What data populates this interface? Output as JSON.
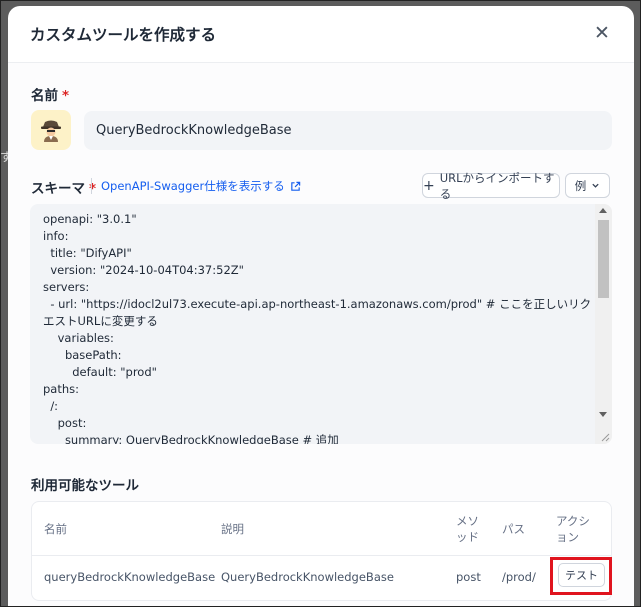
{
  "background": {
    "hint_text": "す"
  },
  "dialog": {
    "title": "カスタムツールを作成する",
    "close_icon": "close-icon",
    "name": {
      "label": "名前",
      "required": "*",
      "value": "QueryBedrockKnowledgeBase",
      "avatar_icon": "detective-icon"
    },
    "schema": {
      "label": "スキーマ",
      "required": "*",
      "swagger_link": "OpenAPI-Swagger仕様を表示する",
      "import_button": "URLからインポートする",
      "example_button": "例",
      "code": "openapi: \"3.0.1\"\ninfo:\n  title: \"DifyAPI\"\n  version: \"2024-10-04T04:37:52Z\"\nservers:\n  - url: \"https://idocl2ul73.execute-api.ap-northeast-1.amazonaws.com/prod\" # ここを正しいリクエストURLに変更する\n    variables:\n      basePath:\n        default: \"prod\"\npaths:\n  /:\n    post:\n      summary: QueryBedrockKnowledgeBase # 追加\n      operationId: queryBedrockKnowledgeBase # 追加"
    },
    "tools": {
      "label": "利用可能なツール",
      "columns": {
        "name": "名前",
        "description": "説明",
        "method": "メソッド",
        "path": "パス",
        "action": "アクション"
      },
      "rows": [
        {
          "name": "queryBedrockKnowledgeBase",
          "description": "QueryBedrockKnowledgeBase",
          "method": "post",
          "path": "/prod/",
          "action": "テスト"
        }
      ]
    }
  },
  "colors": {
    "accent": "#155eef",
    "required": "#dc2626",
    "highlight": "#e0141e"
  }
}
